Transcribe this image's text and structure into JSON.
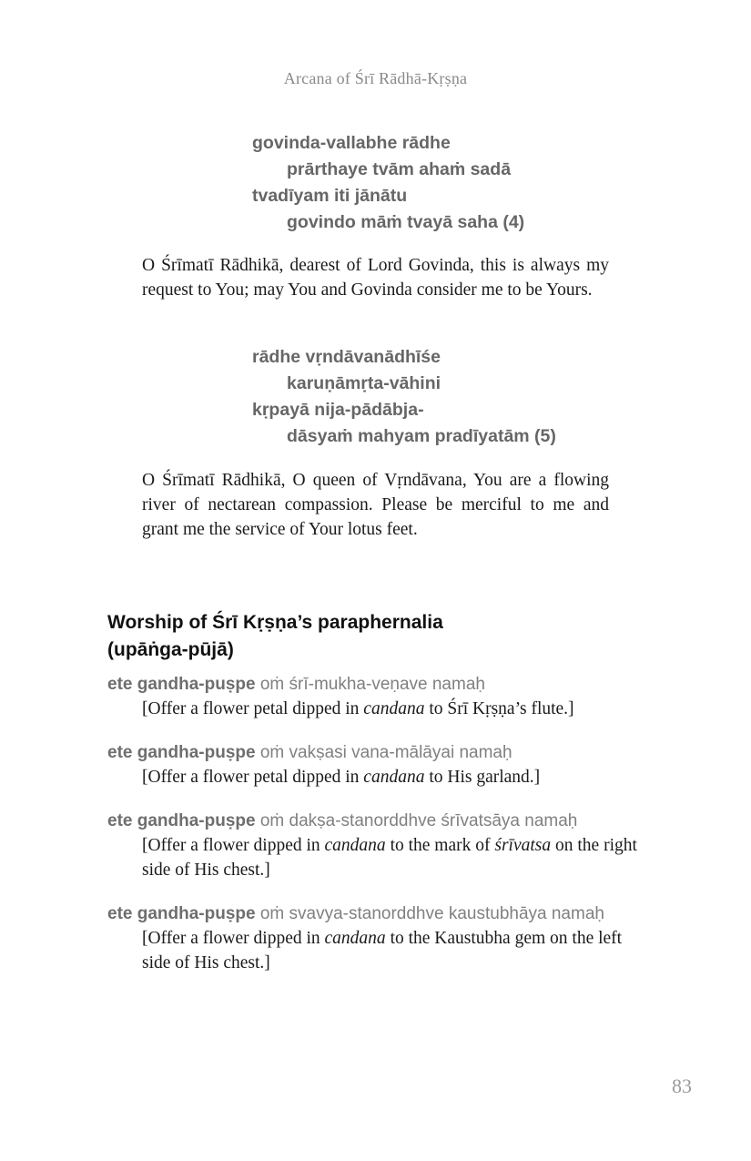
{
  "header": {
    "running_title": "Arcana of Śrī Rādhā-Kṛṣṇa"
  },
  "verse4": {
    "lines": [
      "govinda-vallabhe rādhe",
      "prārthaye tvām ahaṁ sadā",
      "tvadīyam iti jānātu",
      "govindo māṁ tvayā saha (4)"
    ]
  },
  "translation4": "O Śrīmatī Rādhikā, dearest of Lord Govinda, this is always my request to You; may You and Govinda consider me to be Yours.",
  "verse5": {
    "lines": [
      "rādhe vṛndāvanādhīśe",
      "karuṇāmṛta-vāhini",
      "kṛpayā nija-pādābja-",
      "dāsyaṁ mahyam pradīyatām (5)"
    ]
  },
  "translation5": "O Śrīmatī Rādhikā, O queen of Vṛndāvana, You are a flowing river of nectarean compassion. Please be merciful to me and grant me the service of Your lotus feet.",
  "section": {
    "title_line1": "Worship of Śrī Kṛṣṇa’s paraphernalia",
    "title_line2": "(upāṅga-pūjā)"
  },
  "mantras": [
    {
      "lead": "ete gandha-puṣpe",
      "mantra": " oṁ śrī-mukha-veṇave namaḥ",
      "instr_a": "[Offer a flower petal dipped in ",
      "instr_i1": "candana",
      "instr_b": " to Śrī Kṛṣṇa’s flute.]"
    },
    {
      "lead": "ete gandha-puṣpe",
      "mantra": " oṁ vakṣasi vana-mālāyai namaḥ",
      "instr_a": "[Offer a flower petal dipped in ",
      "instr_i1": "candana",
      "instr_b": " to His garland.]"
    },
    {
      "lead": "ete gandha-puṣpe",
      "mantra": " oṁ dakṣa-stanorddhve śrīvatsāya namaḥ",
      "instr_a": "[Offer a flower dipped in ",
      "instr_i1": "candana",
      "instr_b": " to the mark of ",
      "instr_i2": "śrīvatsa",
      "instr_c": " on the right side of His chest.]"
    },
    {
      "lead": "ete gandha-puṣpe",
      "mantra": " oṁ svavya-stanorddhve kaustubhāya namaḥ",
      "instr_a": "[Offer a flower dipped in ",
      "instr_i1": "candana",
      "instr_b": " to the Kaustubha gem on the left side of His chest.]"
    }
  ],
  "page_number": "83"
}
